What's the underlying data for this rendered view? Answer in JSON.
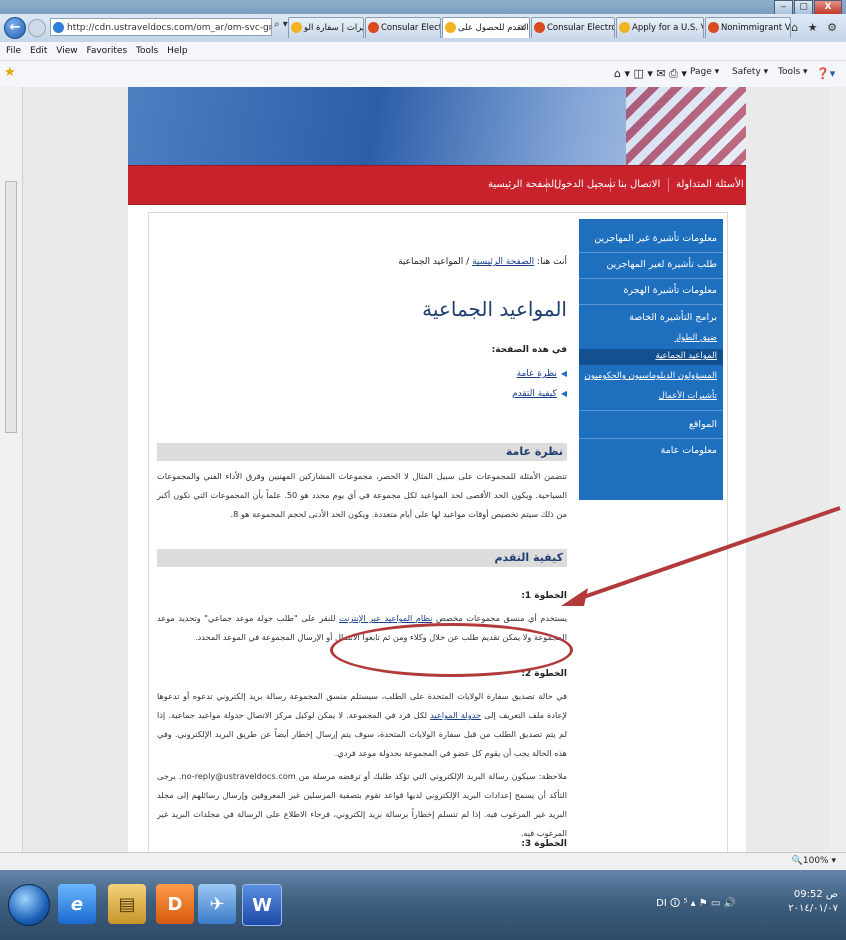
{
  "window": {
    "title": "",
    "minimize": "‒",
    "maximize": "▢",
    "close": "X"
  },
  "browser": {
    "address": "http://cdn.ustraveldocs.com/om_ar/om-svc-gn",
    "address_controls": "⌕ ▾ ⊠ ↻ ✕",
    "tabs": [
      {
        "label": "التأشيرات | سفارة الو...",
        "color": "#f2b321"
      },
      {
        "label": "Consular Electroni...",
        "color": "#d94a1f"
      },
      {
        "label": "التقدم للحصول على...",
        "color": "#f2b321",
        "active": true,
        "close": "✕"
      },
      {
        "label": "Consular Electroni...",
        "color": "#d94a1f"
      },
      {
        "label": "Apply for a U.S. Vis...",
        "color": "#f2b321"
      },
      {
        "label": "Nonimmigrant Vis...",
        "color": "#d94a1f"
      }
    ],
    "nav_icons": "⌂ ★ ⚙",
    "menu": [
      "File",
      "Edit",
      "View",
      "Favorites",
      "Tools",
      "Help"
    ],
    "commands": {
      "page": "Page ▾",
      "safety": "Safety ▾",
      "tools": "Tools ▾"
    },
    "zoom": "🔍100% ▾"
  },
  "site": {
    "nav": [
      "الأسئلة المتداولة",
      "الاتصال بنا",
      "تسجيل الدخول",
      "الصفحة الرئيسية"
    ],
    "sidebar": [
      "معلومات تأشيرة غير المهاجرين",
      "طلب تأشيرة لغير المهاجرين",
      "معلومات تأشيرة الهجرة",
      "برامج التأشيرة الخاصة",
      "ضبق الطوار",
      "المواعيد الجماعية",
      "المسؤولون الدبلوماسيون والحكوميون",
      "تأشيرات الأعمال",
      "المواقع",
      "معلومات عامة"
    ]
  },
  "content": {
    "breadcrumb_prefix": "أنت هنا:",
    "breadcrumb_link": "الصفحة الرئيسية",
    "breadcrumb_rest": "/ المواعيد الجماعية",
    "title": "المواعيد الجماعية",
    "in_page": "في هذه الصفحة:",
    "toc": [
      "نظرة عامة",
      "كيفية التقدم"
    ],
    "overview_head": "نظرة عامة",
    "overview_text": "تتضمن الأمثلة للمجموعات على سبيل المثال لا الحصر، مجموعات المشاركين المهنيين وفرق الأداء الفني والمجموعات السياحية. ويكون الحد الأقصى لحد المواعيد لكل مجموعة في أي يوم محدد هو 50. علماً بأن المجموعات التي تكون أكبر من ذلك سيتم تخصيص أوقات مواعيد لها على أيام متعددة. ويكون الحد الأدنى لحجم المجموعة هو 8.",
    "apply_head": "كيفية التقدم",
    "step1_head": "الخطوة 1:",
    "step1_text_a": "يستخدم أي منسق مجموعات مخصص",
    "step1_link": "نظام المواعيد عبر الإنترنت",
    "step1_text_b": "للنقر على \"طلب جولة موعد جماعي\" وتحديد موعد المجموعة ولا يمكن تقديم طلب عن خلال وكلاء ومن ثم تابعوا الاتصال أو الإرسال المجموعة في الموعد المحدد.",
    "step2_head": "الخطوة 2:",
    "step2_text_a": "في حالة تصديق سفارة الولايات المتحدة على الطلب، سيستلم منسق المجموعة رسالة بريد إلكتروني تدعوه أو تدعوها لإعادة ملف التعريف إلى",
    "step2_link": "جدولة المواعيد",
    "step2_text_b": "لكل فرد في المجموعة. لا يمكن لوكيل مركز الاتصال جدولة مواعيد جماعية. إذا لم يتم تصديق الطلب من قبل سفارة الولايات المتحدة، سوف يتم إرسال إخطار أيضاً عن طريق البريد الإلكتروني. وفي هذه الحالة يجب أن يقوم كل عضو في المجموعة بجدولة موعد فردي.",
    "note_text": "ملاحظة: سيكون رسالة البريد الإلكتروني التي تؤكد طلبك أو ترفضه مرسلة من no-reply@ustraveldocs.com. يرجى التأكد أن يسمح إعدادات البريد الإلكتروني لديها قواعد تقوم بتصفية المرسلين غير المعروفين وإرسال رسائلهم إلى مجلد البريد غير المرغوب فيه. إذا لم تتسلم إخطاراً برسالة بريد إلكتروني، فرجاء الاطلاع على الرسالة في مجلدات البريد غير المرغوب فيه.",
    "step3_head": "الخطوة 3:"
  },
  "taskbar": {
    "apps": [
      "e",
      "▤",
      "D",
      "✈",
      "W"
    ],
    "tray": "DI 🛈 ⁵ ▴ ⚑ ▭ 🔊",
    "clock_time": "09:52 ص",
    "clock_date": "٢٠١٤/٠١/٠٧"
  }
}
